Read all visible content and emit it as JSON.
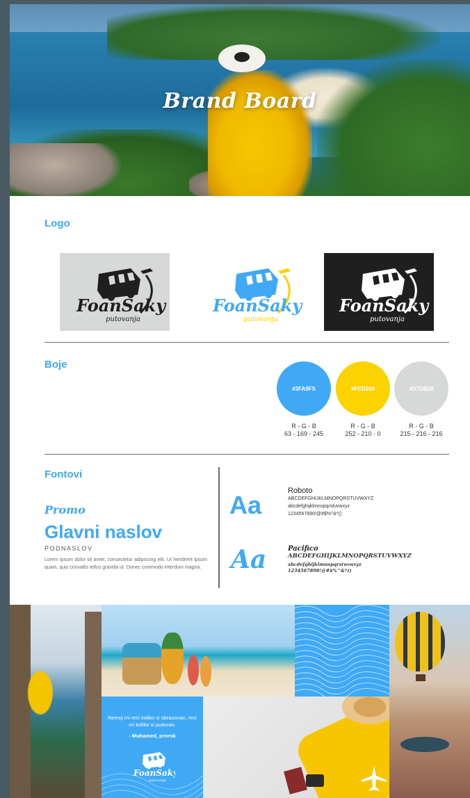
{
  "hero": {
    "title": "Brand Board"
  },
  "sections": {
    "logo": "Logo",
    "colors": "Boje",
    "fonts": "Fontovi"
  },
  "logo": {
    "wordmark": "FoanSaky",
    "tagline": "putovanja"
  },
  "colors": [
    {
      "hex": "#3FA9FS",
      "fill": "#3FA9F5",
      "rgb_label": "R - G - B",
      "rgb": "63 - 169 - 245"
    },
    {
      "hex": "#FCD200",
      "fill": "#FCD200",
      "rgb_label": "R - G - B",
      "rgb": "252 - 210 - 0"
    },
    {
      "hex": "#D7D8D8",
      "fill": "#D7D8D8",
      "rgb_label": "R - G - B",
      "rgb": "215 - 216 - 216"
    }
  ],
  "typography": {
    "promo": "Promo",
    "headline": "Glavni naslov",
    "subhead": "PODNASLOV",
    "body": "Lorem ipsum dolor sit amet, consectetur adipiscing elit. Ut hendrerit ipsum quam, quis convallis tellus gravida ut. Donec commodo interdum magna.",
    "sample_glyph": "Aa",
    "roboto": {
      "name": "Roboto",
      "upper": "ABCDEFGHIJKLMNOPQRSTUVWXYZ",
      "lower": "abcdefghijklmnopqrstuvwxyz",
      "digits": "1234567890!@#$%^&*()"
    },
    "pacifico": {
      "name": "Pacifico",
      "upper": "ABCDEFGHIJKLMNOPQRSTUVWXYZ",
      "lower": "abcdefghijklmnopqrstuvwxyz",
      "digits": "1234567890!@#$%^&*()"
    }
  },
  "quote": {
    "text": "Nemoj mi reći koliko si obrazovan, reci mi koliko si putovao.",
    "author": "- Muhamed, prorok"
  },
  "brand_colors": {
    "blue": "#3FA9F5",
    "yellow": "#FCD200",
    "gray": "#D7D8D8",
    "dark": "#1F1F1F"
  }
}
